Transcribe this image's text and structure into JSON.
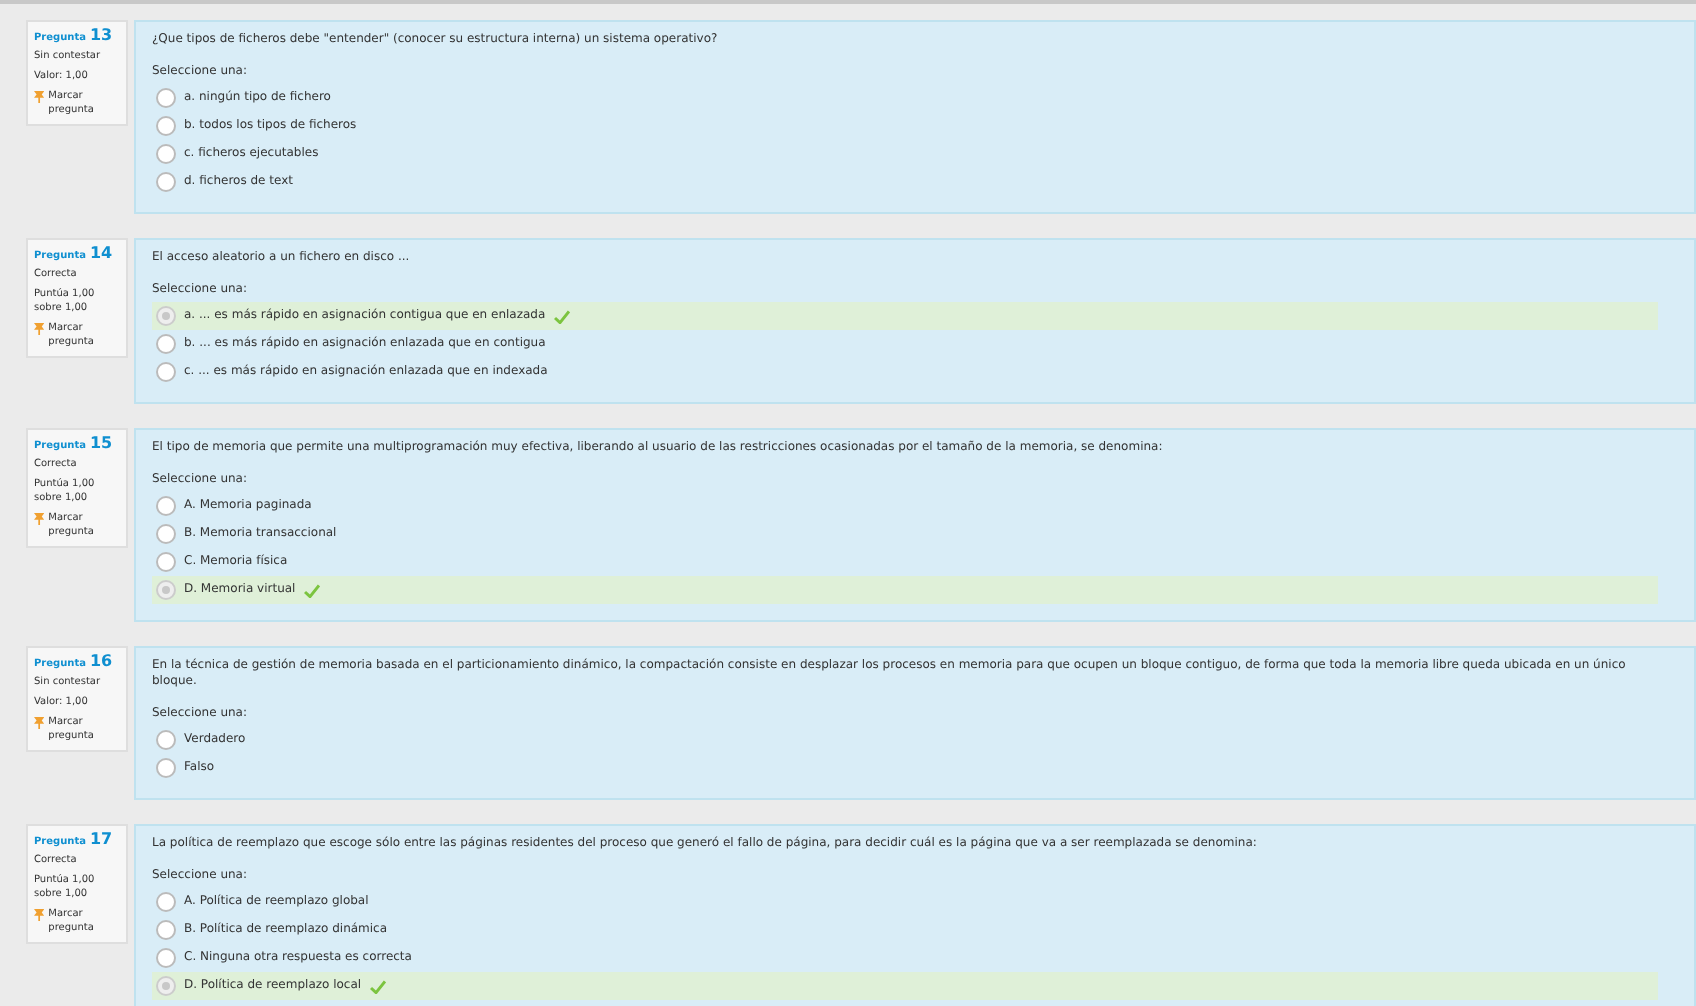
{
  "questions": [
    {
      "label": "Pregunta",
      "number": "13",
      "status": "Sin contestar",
      "grade": "Valor: 1,00",
      "flag": "Marcar pregunta",
      "text": "¿Que tipos de ficheros debe \"entender\" (conocer su estructura interna) un sistema operativo?",
      "prompt": "Seleccione una:",
      "answers": [
        {
          "text": "a. ningún tipo de fichero",
          "selected": false,
          "correct": false
        },
        {
          "text": "b. todos los tipos de ficheros",
          "selected": false,
          "correct": false
        },
        {
          "text": "c. ficheros ejecutables",
          "selected": false,
          "correct": false
        },
        {
          "text": "d. ficheros de text",
          "selected": false,
          "correct": false
        }
      ]
    },
    {
      "label": "Pregunta",
      "number": "14",
      "status": "Correcta",
      "grade": "Puntúa 1,00 sobre 1,00",
      "flag": "Marcar pregunta",
      "text": "El acceso aleatorio a un fichero en disco ...",
      "prompt": "Seleccione una:",
      "answers": [
        {
          "text": "a. ... es más rápido en asignación contigua que en enlazada",
          "selected": true,
          "correct": true
        },
        {
          "text": "b. ... es más rápido en asignación enlazada que en contigua",
          "selected": false,
          "correct": false
        },
        {
          "text": "c. ... es más rápido en asignación enlazada que en indexada",
          "selected": false,
          "correct": false
        }
      ]
    },
    {
      "label": "Pregunta",
      "number": "15",
      "status": "Correcta",
      "grade": "Puntúa 1,00 sobre 1,00",
      "flag": "Marcar pregunta",
      "text": "El tipo de memoria que permite una multiprogramación muy efectiva, liberando al usuario de las restricciones ocasionadas por el tamaño de la memoria, se denomina:",
      "prompt": "Seleccione una:",
      "answers": [
        {
          "text": "A. Memoria paginada",
          "selected": false,
          "correct": false
        },
        {
          "text": "B. Memoria transaccional",
          "selected": false,
          "correct": false
        },
        {
          "text": "C. Memoria física",
          "selected": false,
          "correct": false
        },
        {
          "text": "D. Memoria virtual",
          "selected": true,
          "correct": true
        }
      ]
    },
    {
      "label": "Pregunta",
      "number": "16",
      "status": "Sin contestar",
      "grade": "Valor: 1,00",
      "flag": "Marcar pregunta",
      "text": "En la técnica de gestión de memoria basada en el particionamiento dinámico, la compactación consiste en desplazar los procesos en memoria para que ocupen un bloque contiguo, de forma que toda la memoria libre queda ubicada en un único bloque.",
      "prompt": "Seleccione una:",
      "answers": [
        {
          "text": "Verdadero",
          "selected": false,
          "correct": false
        },
        {
          "text": "Falso",
          "selected": false,
          "correct": false
        }
      ]
    },
    {
      "label": "Pregunta",
      "number": "17",
      "status": "Correcta",
      "grade": "Puntúa 1,00 sobre 1,00",
      "flag": "Marcar pregunta",
      "text": "La política de reemplazo que escoge sólo entre las páginas residentes del proceso que generó el fallo de página, para decidir cuál es la página que va a ser reemplazada se denomina:",
      "prompt": "Seleccione una:",
      "answers": [
        {
          "text": "A. Política de reemplazo global",
          "selected": false,
          "correct": false
        },
        {
          "text": "B. Política de reemplazo dinámica",
          "selected": false,
          "correct": false
        },
        {
          "text": "C. Ninguna otra respuesta es correcta",
          "selected": false,
          "correct": false
        },
        {
          "text": "D. Política de reemplazo local",
          "selected": true,
          "correct": true
        }
      ]
    }
  ]
}
